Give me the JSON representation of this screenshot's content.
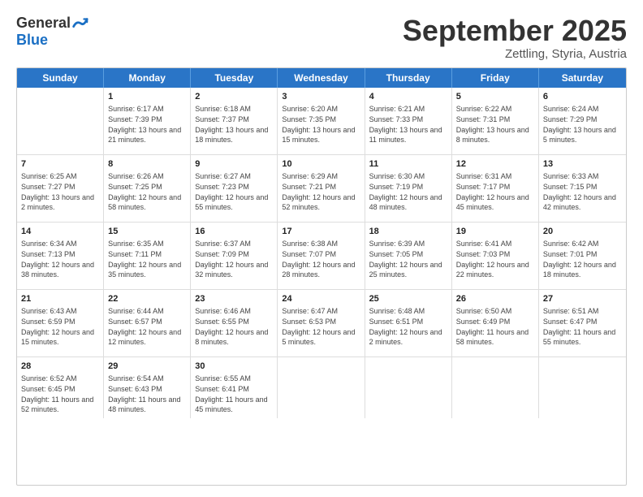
{
  "logo": {
    "general": "General",
    "blue": "Blue"
  },
  "title": {
    "month": "September 2025",
    "location": "Zettling, Styria, Austria"
  },
  "days": [
    "Sunday",
    "Monday",
    "Tuesday",
    "Wednesday",
    "Thursday",
    "Friday",
    "Saturday"
  ],
  "weeks": [
    [
      {
        "date": "",
        "sunrise": "",
        "sunset": "",
        "daylight": ""
      },
      {
        "date": "1",
        "sunrise": "Sunrise: 6:17 AM",
        "sunset": "Sunset: 7:39 PM",
        "daylight": "Daylight: 13 hours and 21 minutes."
      },
      {
        "date": "2",
        "sunrise": "Sunrise: 6:18 AM",
        "sunset": "Sunset: 7:37 PM",
        "daylight": "Daylight: 13 hours and 18 minutes."
      },
      {
        "date": "3",
        "sunrise": "Sunrise: 6:20 AM",
        "sunset": "Sunset: 7:35 PM",
        "daylight": "Daylight: 13 hours and 15 minutes."
      },
      {
        "date": "4",
        "sunrise": "Sunrise: 6:21 AM",
        "sunset": "Sunset: 7:33 PM",
        "daylight": "Daylight: 13 hours and 11 minutes."
      },
      {
        "date": "5",
        "sunrise": "Sunrise: 6:22 AM",
        "sunset": "Sunset: 7:31 PM",
        "daylight": "Daylight: 13 hours and 8 minutes."
      },
      {
        "date": "6",
        "sunrise": "Sunrise: 6:24 AM",
        "sunset": "Sunset: 7:29 PM",
        "daylight": "Daylight: 13 hours and 5 minutes."
      }
    ],
    [
      {
        "date": "7",
        "sunrise": "Sunrise: 6:25 AM",
        "sunset": "Sunset: 7:27 PM",
        "daylight": "Daylight: 13 hours and 2 minutes."
      },
      {
        "date": "8",
        "sunrise": "Sunrise: 6:26 AM",
        "sunset": "Sunset: 7:25 PM",
        "daylight": "Daylight: 12 hours and 58 minutes."
      },
      {
        "date": "9",
        "sunrise": "Sunrise: 6:27 AM",
        "sunset": "Sunset: 7:23 PM",
        "daylight": "Daylight: 12 hours and 55 minutes."
      },
      {
        "date": "10",
        "sunrise": "Sunrise: 6:29 AM",
        "sunset": "Sunset: 7:21 PM",
        "daylight": "Daylight: 12 hours and 52 minutes."
      },
      {
        "date": "11",
        "sunrise": "Sunrise: 6:30 AM",
        "sunset": "Sunset: 7:19 PM",
        "daylight": "Daylight: 12 hours and 48 minutes."
      },
      {
        "date": "12",
        "sunrise": "Sunrise: 6:31 AM",
        "sunset": "Sunset: 7:17 PM",
        "daylight": "Daylight: 12 hours and 45 minutes."
      },
      {
        "date": "13",
        "sunrise": "Sunrise: 6:33 AM",
        "sunset": "Sunset: 7:15 PM",
        "daylight": "Daylight: 12 hours and 42 minutes."
      }
    ],
    [
      {
        "date": "14",
        "sunrise": "Sunrise: 6:34 AM",
        "sunset": "Sunset: 7:13 PM",
        "daylight": "Daylight: 12 hours and 38 minutes."
      },
      {
        "date": "15",
        "sunrise": "Sunrise: 6:35 AM",
        "sunset": "Sunset: 7:11 PM",
        "daylight": "Daylight: 12 hours and 35 minutes."
      },
      {
        "date": "16",
        "sunrise": "Sunrise: 6:37 AM",
        "sunset": "Sunset: 7:09 PM",
        "daylight": "Daylight: 12 hours and 32 minutes."
      },
      {
        "date": "17",
        "sunrise": "Sunrise: 6:38 AM",
        "sunset": "Sunset: 7:07 PM",
        "daylight": "Daylight: 12 hours and 28 minutes."
      },
      {
        "date": "18",
        "sunrise": "Sunrise: 6:39 AM",
        "sunset": "Sunset: 7:05 PM",
        "daylight": "Daylight: 12 hours and 25 minutes."
      },
      {
        "date": "19",
        "sunrise": "Sunrise: 6:41 AM",
        "sunset": "Sunset: 7:03 PM",
        "daylight": "Daylight: 12 hours and 22 minutes."
      },
      {
        "date": "20",
        "sunrise": "Sunrise: 6:42 AM",
        "sunset": "Sunset: 7:01 PM",
        "daylight": "Daylight: 12 hours and 18 minutes."
      }
    ],
    [
      {
        "date": "21",
        "sunrise": "Sunrise: 6:43 AM",
        "sunset": "Sunset: 6:59 PM",
        "daylight": "Daylight: 12 hours and 15 minutes."
      },
      {
        "date": "22",
        "sunrise": "Sunrise: 6:44 AM",
        "sunset": "Sunset: 6:57 PM",
        "daylight": "Daylight: 12 hours and 12 minutes."
      },
      {
        "date": "23",
        "sunrise": "Sunrise: 6:46 AM",
        "sunset": "Sunset: 6:55 PM",
        "daylight": "Daylight: 12 hours and 8 minutes."
      },
      {
        "date": "24",
        "sunrise": "Sunrise: 6:47 AM",
        "sunset": "Sunset: 6:53 PM",
        "daylight": "Daylight: 12 hours and 5 minutes."
      },
      {
        "date": "25",
        "sunrise": "Sunrise: 6:48 AM",
        "sunset": "Sunset: 6:51 PM",
        "daylight": "Daylight: 12 hours and 2 minutes."
      },
      {
        "date": "26",
        "sunrise": "Sunrise: 6:50 AM",
        "sunset": "Sunset: 6:49 PM",
        "daylight": "Daylight: 11 hours and 58 minutes."
      },
      {
        "date": "27",
        "sunrise": "Sunrise: 6:51 AM",
        "sunset": "Sunset: 6:47 PM",
        "daylight": "Daylight: 11 hours and 55 minutes."
      }
    ],
    [
      {
        "date": "28",
        "sunrise": "Sunrise: 6:52 AM",
        "sunset": "Sunset: 6:45 PM",
        "daylight": "Daylight: 11 hours and 52 minutes."
      },
      {
        "date": "29",
        "sunrise": "Sunrise: 6:54 AM",
        "sunset": "Sunset: 6:43 PM",
        "daylight": "Daylight: 11 hours and 48 minutes."
      },
      {
        "date": "30",
        "sunrise": "Sunrise: 6:55 AM",
        "sunset": "Sunset: 6:41 PM",
        "daylight": "Daylight: 11 hours and 45 minutes."
      },
      {
        "date": "",
        "sunrise": "",
        "sunset": "",
        "daylight": ""
      },
      {
        "date": "",
        "sunrise": "",
        "sunset": "",
        "daylight": ""
      },
      {
        "date": "",
        "sunrise": "",
        "sunset": "",
        "daylight": ""
      },
      {
        "date": "",
        "sunrise": "",
        "sunset": "",
        "daylight": ""
      }
    ]
  ]
}
